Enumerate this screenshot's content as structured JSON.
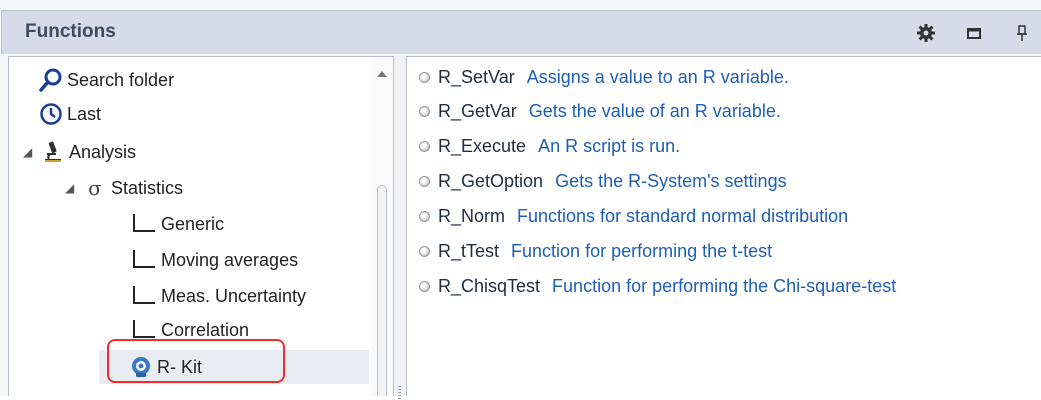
{
  "panel": {
    "title": "Functions"
  },
  "title_bar_icons": [
    "gear-icon",
    "maximize-icon",
    "pin-icon"
  ],
  "tree": {
    "items": [
      {
        "label": "Search folder",
        "icon": "search-icon"
      },
      {
        "label": "Last",
        "icon": "clock-icon"
      },
      {
        "label": "Analysis",
        "icon": "microscope-icon",
        "expanded": true
      },
      {
        "label": "Statistics",
        "icon": "sigma-icon",
        "expanded": true
      },
      {
        "label": "Generic",
        "icon": "tree-connector-icon"
      },
      {
        "label": "Moving averages",
        "icon": "tree-connector-icon"
      },
      {
        "label": "Meas. Uncertainty",
        "icon": "tree-connector-icon"
      },
      {
        "label": "Correlation",
        "icon": "tree-connector-icon"
      },
      {
        "label": "R- Kit",
        "icon": "r-kit-icon",
        "selected": true
      }
    ]
  },
  "functions": [
    {
      "name": "R_SetVar",
      "description": "Assigns a value to an R variable."
    },
    {
      "name": "R_GetVar",
      "description": "Gets the value of an R variable."
    },
    {
      "name": "R_Execute",
      "description": "An R script is run."
    },
    {
      "name": "R_GetOption",
      "description": "Gets the R-System's settings"
    },
    {
      "name": "R_Norm",
      "description": "Functions for standard normal distribution"
    },
    {
      "name": "R_tTest",
      "description": "Function for performing the t-test"
    },
    {
      "name": "R_ChisqTest",
      "description": "Function for performing the Chi-square-test"
    }
  ],
  "colors": {
    "highlight": "#ef2b2b",
    "link": "#1d5fb4",
    "title_bar": "#d6dbe7"
  }
}
